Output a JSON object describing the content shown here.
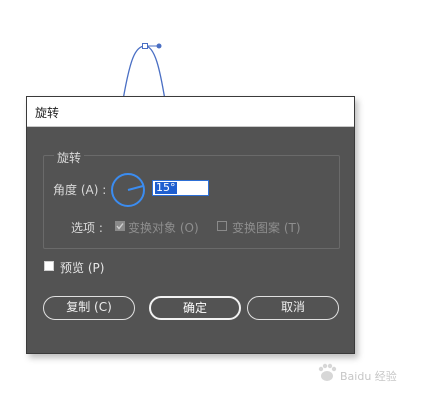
{
  "dialog": {
    "title": "旋转",
    "group_label": "旋转",
    "angle_label": "角度 (A) :",
    "angle_value": "15°",
    "options_label": "选项 :",
    "option_transform_objects": "变换对象 (O)",
    "option_transform_patterns": "变换图案 (T)",
    "preview_label": "预览 (P)",
    "buttons": {
      "copy": "复制 (C)",
      "ok": "确定",
      "cancel": "取消"
    }
  },
  "watermark": {
    "text": "Baidu 经验"
  },
  "colors": {
    "dialog_bg": "#535353",
    "accent": "#3b8cf0",
    "selection": "#1f5fd0",
    "curve": "#4a6fc4"
  }
}
